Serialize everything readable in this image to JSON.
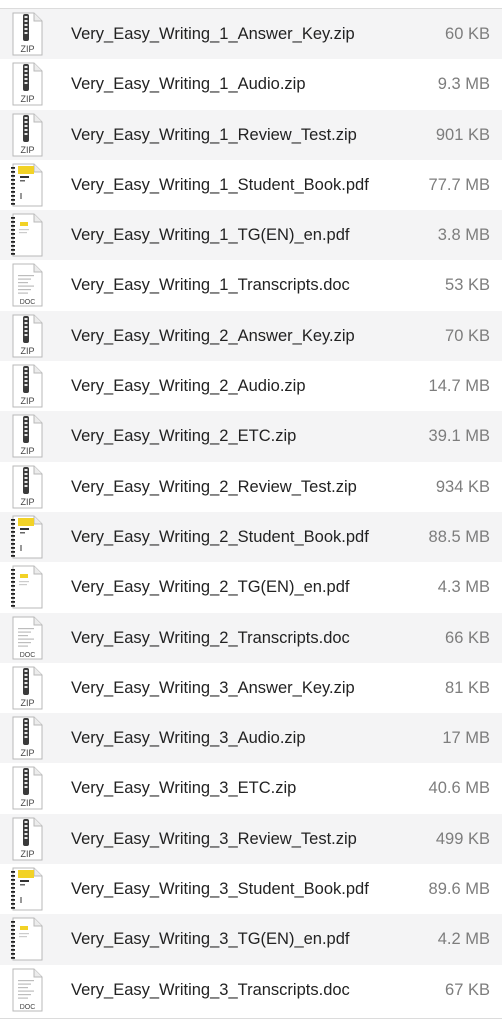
{
  "colors": {
    "row_alt": "#f4f4f5",
    "name": "#222222",
    "size": "#7d7d7d",
    "pdf_accent": "#f2d226"
  },
  "files": [
    {
      "name": "Very_Easy_Writing_1_Answer_Key.zip",
      "size": "60 KB",
      "kind": "zip",
      "icon_label": "ZIP"
    },
    {
      "name": "Very_Easy_Writing_1_Audio.zip",
      "size": "9.3 MB",
      "kind": "zip",
      "icon_label": "ZIP"
    },
    {
      "name": "Very_Easy_Writing_1_Review_Test.zip",
      "size": "901 KB",
      "kind": "zip",
      "icon_label": "ZIP"
    },
    {
      "name": "Very_Easy_Writing_1_Student_Book.pdf",
      "size": "77.7 MB",
      "kind": "pdf-book",
      "icon_label": ""
    },
    {
      "name": "Very_Easy_Writing_1_TG(EN)_en.pdf",
      "size": "3.8 MB",
      "kind": "pdf-guide",
      "icon_label": ""
    },
    {
      "name": "Very_Easy_Writing_1_Transcripts.doc",
      "size": "53 KB",
      "kind": "doc",
      "icon_label": "DOC"
    },
    {
      "name": "Very_Easy_Writing_2_Answer_Key.zip",
      "size": "70 KB",
      "kind": "zip",
      "icon_label": "ZIP"
    },
    {
      "name": "Very_Easy_Writing_2_Audio.zip",
      "size": "14.7 MB",
      "kind": "zip",
      "icon_label": "ZIP"
    },
    {
      "name": "Very_Easy_Writing_2_ETC.zip",
      "size": "39.1 MB",
      "kind": "zip",
      "icon_label": "ZIP"
    },
    {
      "name": "Very_Easy_Writing_2_Review_Test.zip",
      "size": "934 KB",
      "kind": "zip",
      "icon_label": "ZIP"
    },
    {
      "name": "Very_Easy_Writing_2_Student_Book.pdf",
      "size": "88.5 MB",
      "kind": "pdf-book",
      "icon_label": ""
    },
    {
      "name": "Very_Easy_Writing_2_TG(EN)_en.pdf",
      "size": "4.3 MB",
      "kind": "pdf-guide",
      "icon_label": ""
    },
    {
      "name": "Very_Easy_Writing_2_Transcripts.doc",
      "size": "66 KB",
      "kind": "doc",
      "icon_label": "DOC"
    },
    {
      "name": "Very_Easy_Writing_3_Answer_Key.zip",
      "size": "81 KB",
      "kind": "zip",
      "icon_label": "ZIP"
    },
    {
      "name": "Very_Easy_Writing_3_Audio.zip",
      "size": "17 MB",
      "kind": "zip",
      "icon_label": "ZIP"
    },
    {
      "name": "Very_Easy_Writing_3_ETC.zip",
      "size": "40.6 MB",
      "kind": "zip",
      "icon_label": "ZIP"
    },
    {
      "name": "Very_Easy_Writing_3_Review_Test.zip",
      "size": "499 KB",
      "kind": "zip",
      "icon_label": "ZIP"
    },
    {
      "name": "Very_Easy_Writing_3_Student_Book.pdf",
      "size": "89.6 MB",
      "kind": "pdf-book",
      "icon_label": ""
    },
    {
      "name": "Very_Easy_Writing_3_TG(EN)_en.pdf",
      "size": "4.2 MB",
      "kind": "pdf-guide",
      "icon_label": ""
    },
    {
      "name": "Very_Easy_Writing_3_Transcripts.doc",
      "size": "67 KB",
      "kind": "doc",
      "icon_label": "DOC"
    }
  ]
}
